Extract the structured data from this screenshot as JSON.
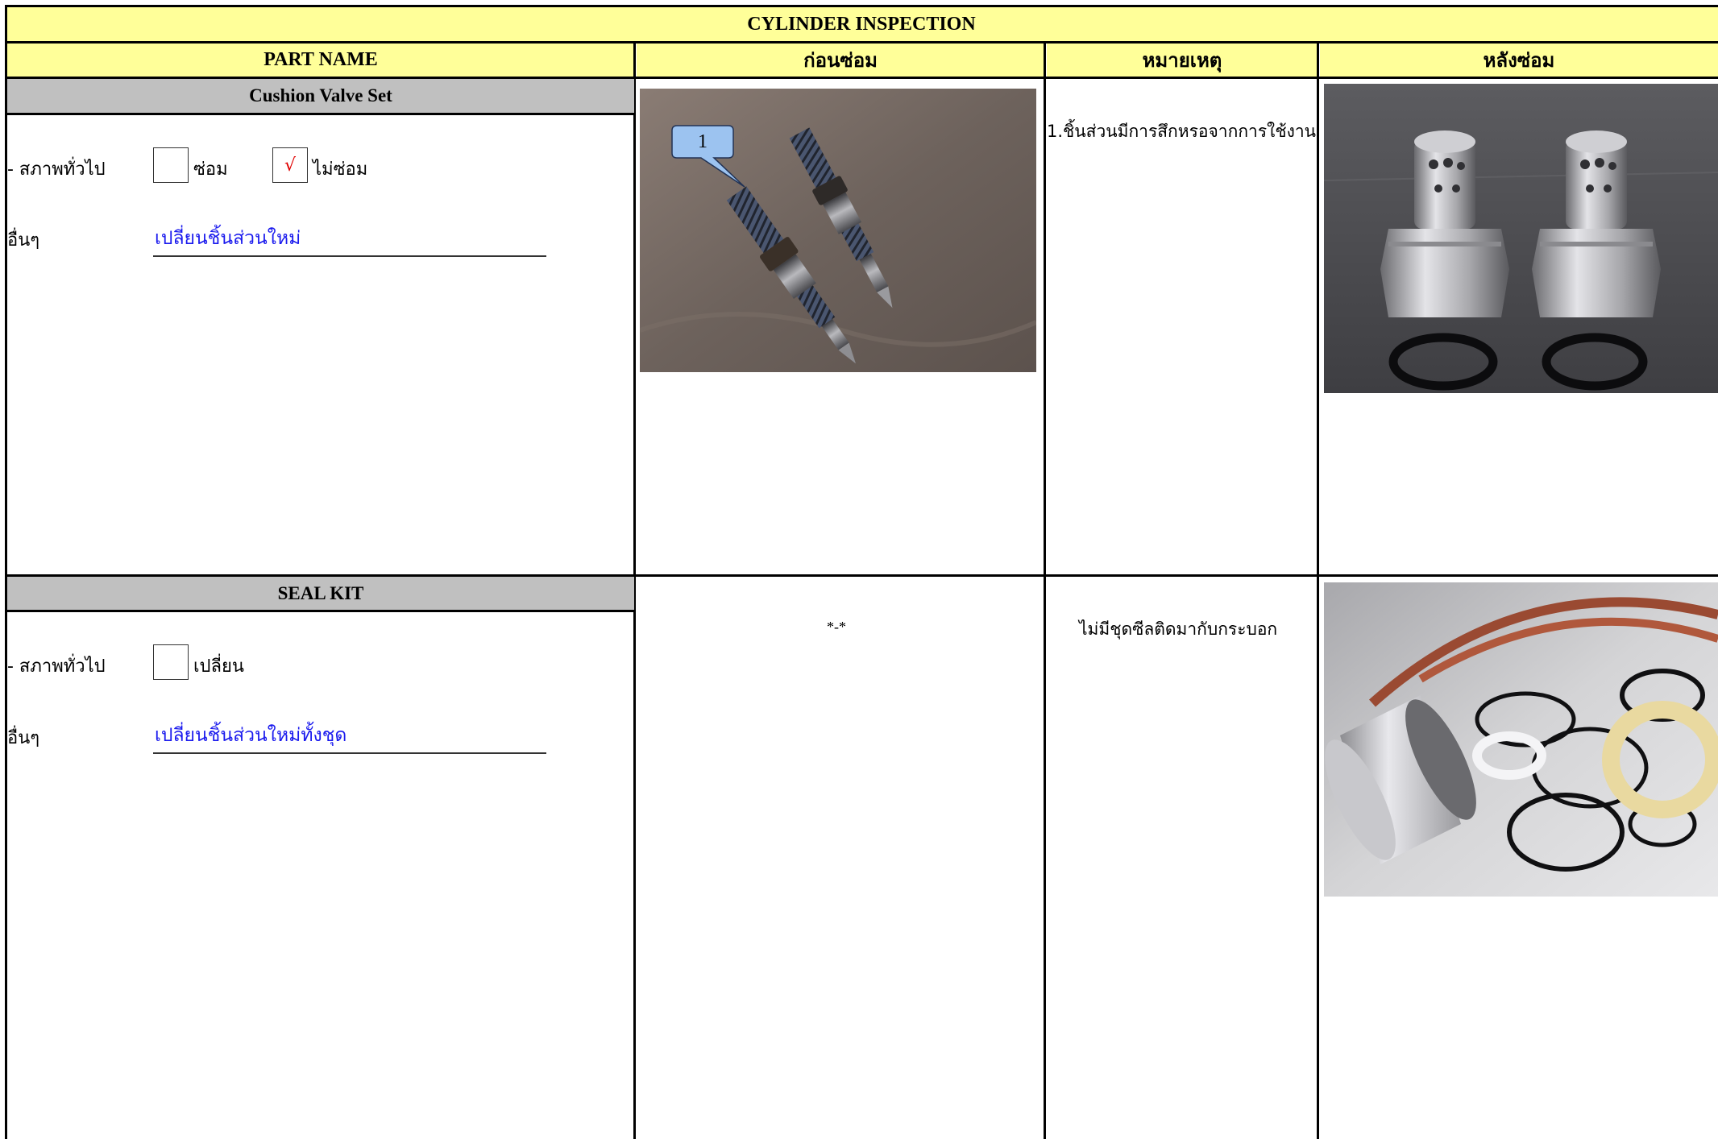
{
  "header": {
    "title": "CYLINDER  INSPECTION",
    "columns": [
      "PART NAME",
      "ก่อนซ่อม",
      "หมายเหตุ",
      "หลังซ่อม"
    ]
  },
  "sections": [
    {
      "name": "Cushion Valve Set",
      "condition_label": "- สภาพทั่วไป",
      "options": [
        {
          "label": "ซ่อม",
          "mark": ""
        },
        {
          "label": "ไม่ซ่อม",
          "mark": "√"
        }
      ],
      "other_label": "อื่นๆ",
      "other_value": "เปลี่ยนชิ้นส่วนใหม่",
      "callout_number": "1",
      "note": "1.ชิ้นส่วนมีการสึกหรอจากการใช้งาน"
    },
    {
      "name": "SEAL KIT",
      "condition_label": "- สภาพทั่วไป",
      "options": [
        {
          "label": "เปลี่ยน",
          "mark": ""
        }
      ],
      "other_label": "อื่นๆ",
      "other_value": "เปลี่ยนชิ้นส่วนใหม่ทั้งชุด",
      "before_placeholder": "*-*",
      "note": "ไม่มีชุดซีลติดมากับกระบอก"
    }
  ],
  "colors": {
    "header_fill": "#ffff99",
    "section_fill": "#c0c0c0",
    "value_text": "#1a1aee",
    "check_mark": "#e00000",
    "callout_fill": "#9cc3f0"
  }
}
